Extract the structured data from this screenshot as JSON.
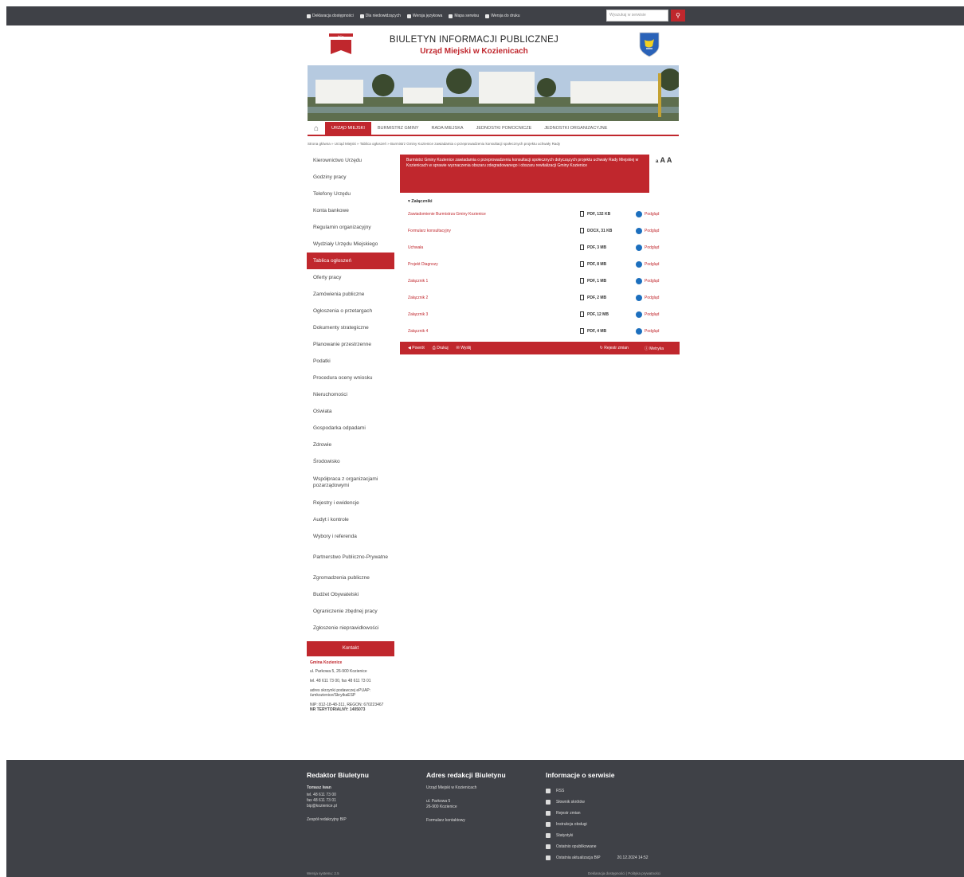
{
  "topbar": {
    "links": [
      {
        "icon": "globe-icon",
        "label": "Deklaracja dostępności"
      },
      {
        "icon": "accessibility-icon",
        "label": "Dla niedowidzących"
      },
      {
        "icon": "sign-language-icon",
        "label": "Wersja językowa"
      },
      {
        "icon": "sitemap-icon",
        "label": "Mapa serwisu"
      },
      {
        "icon": "print-icon",
        "label": "Wersja do druku"
      }
    ],
    "search_placeholder": "Wyszukaj w serwisie",
    "search_icon": "search-icon"
  },
  "header": {
    "logo_text": "bip",
    "title": "BIULETYN INFORMACJI PUBLICZNEJ",
    "subtitle": "Urząd Miejski w Kozienicach"
  },
  "nav": {
    "items": [
      {
        "label": "URZĄD MIEJSKI",
        "active": true
      },
      {
        "label": "BURMISTRZ GMINY",
        "active": false
      },
      {
        "label": "RADA MIEJSKA",
        "active": false
      },
      {
        "label": "JEDNOSTKI POMOCNICZE",
        "active": false
      },
      {
        "label": "JEDNOSTKI ORGANIZACYJNE",
        "active": false
      }
    ]
  },
  "breadcrumb": "Strona główna » Urząd Miejski » Tablica ogłoszeń » Burmistrz Gminy Kozienice zawiadamia o przeprowadzeniu konsultacji społecznych projektu uchwały Rady",
  "sidebar": {
    "items": [
      {
        "label": "Kierownictwo Urzędu"
      },
      {
        "label": "Godziny pracy"
      },
      {
        "label": "Telefony Urzędu"
      },
      {
        "label": "Konta bankowe"
      },
      {
        "label": "Regulamin organizacyjny"
      },
      {
        "label": "Wydziały Urzędu Miejskiego"
      },
      {
        "label": "Tablica ogłoszeń",
        "active": true
      },
      {
        "label": "Oferty pracy"
      },
      {
        "label": "Zamówienia publiczne"
      },
      {
        "label": "Ogłoszenia o przetargach"
      },
      {
        "label": "Dokumenty strategiczne"
      },
      {
        "label": "Planowanie przestrzenne"
      },
      {
        "label": "Podatki"
      },
      {
        "label": "Procedura oceny wniosku"
      },
      {
        "label": "Nieruchomości"
      },
      {
        "label": "Oświata"
      },
      {
        "label": "Gospodarka odpadami"
      },
      {
        "label": "Zdrowie"
      },
      {
        "label": "Środowisko"
      },
      {
        "label": "Współpraca z organizacjami pozarządowymi",
        "tall": true
      },
      {
        "label": "Rejestry i ewidencje"
      },
      {
        "label": "Audyt i kontrole"
      },
      {
        "label": "Wybory i referenda"
      },
      {
        "label": "Partnerstwo Publiczno-Prywatne",
        "tall": true
      },
      {
        "label": "Zgromadzenia publiczne"
      },
      {
        "label": "Budżet Obywatelski"
      },
      {
        "label": "Ograniczenie zbędnej pracy"
      },
      {
        "label": "Zgłoszenie nieprawidłowości"
      }
    ],
    "contact_button": "Kontakt",
    "contact": {
      "name": "Gmina Kozienice",
      "lines": [
        "ul. Parkowa 5, 26-900 Kozienice",
        "tel. 48 611 73 00, fax 48 611 73 01",
        "adres skrzynki podawczej ePUAP: /umkozienice/SkrytkaESP",
        "NIP: 812-18-48-311, REGON: 670223467",
        "NR TERYTORIALNY: 1405073"
      ]
    }
  },
  "notice": "Burmistrz Gminy Kozienice zawiadamia o przeprowadzeniu konsultacji społecznych dotyczących projektu uchwały Rady Miejskiej w Kozienicach w sprawie wyznaczenia obszaru zdegradowanego i obszaru rewitalizacji Gminy Kozienice",
  "font_controls": {
    "small": "a",
    "medium": "A",
    "large": "A"
  },
  "attachments": {
    "title": "Załączniki",
    "files": [
      {
        "name": "Zawiadomienie Burmistrza Gminy Kozienice",
        "size": "PDF, 132 KB",
        "view": "Podgląd"
      },
      {
        "name": "Formularz konsultacyjny",
        "size": "DOCX, 31 KB",
        "view": "Podgląd"
      },
      {
        "name": "Uchwała",
        "size": "PDF, 3 MB",
        "view": "Podgląd"
      },
      {
        "name": "Projekt Diagnozy",
        "size": "PDF, 8 MB",
        "view": "Podgląd"
      },
      {
        "name": "Załącznik 1",
        "size": "PDF, 1 MB",
        "view": "Podgląd"
      },
      {
        "name": "Załącznik 2",
        "size": "PDF, 2 MB",
        "view": "Podgląd"
      },
      {
        "name": "Załącznik 3",
        "size": "PDF, 12 MB",
        "view": "Podgląd"
      },
      {
        "name": "Załącznik 4",
        "size": "PDF, 4 MB",
        "view": "Podgląd"
      }
    ]
  },
  "toolbar": {
    "back": "Powrót",
    "print": "Drukuj",
    "send": "Wyślij",
    "history": "Rejestr zmian",
    "metrics": "Metryka"
  },
  "footer": {
    "col1": {
      "title": "Redaktor Biuletynu",
      "name": "Tomasz Iwan",
      "lines": [
        "tel. 48 611 73 00",
        "fax 48 611 73 01",
        "bip@kozienice.pl"
      ],
      "link": "Zespół redakcyjny BIP"
    },
    "col2": {
      "title": "Adres redakcji Biuletynu",
      "office": "Urząd Miejski w Kozienicach",
      "address": [
        "ul. Parkowa 5",
        "26-900 Kozienice"
      ],
      "link": "Formularz kontaktowy"
    },
    "col3": {
      "title": "Informacje o serwisie",
      "items": [
        {
          "icon": "rss-icon",
          "label": "RSS"
        },
        {
          "icon": "book-icon",
          "label": "Słownik skrótów"
        },
        {
          "icon": "history-icon",
          "label": "Rejestr zmian"
        },
        {
          "icon": "info-icon",
          "label": "Instrukcja obsługi"
        },
        {
          "icon": "chart-icon",
          "label": "Statystyki"
        },
        {
          "icon": "doc-icon",
          "label": "Ostatnio opublikowane"
        },
        {
          "icon": "clock-icon",
          "label": "Ostatnia aktualizacja BIP",
          "value": "20.12.2024 14:52"
        }
      ]
    },
    "bottom_left": "Wersja systemu: 2.5",
    "bottom_right": "Deklaracja dostępności | Polityka prywatności"
  }
}
